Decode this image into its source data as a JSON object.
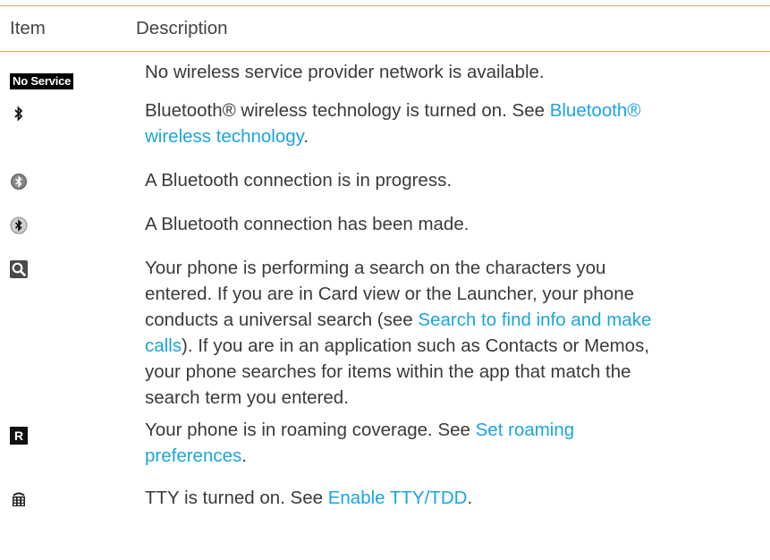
{
  "table": {
    "header": {
      "item": "Item",
      "description": "Description"
    },
    "rows": [
      {
        "icon": "no-service-icon",
        "icon_text": "No Service",
        "text": "No wireless service provider network is available."
      },
      {
        "icon": "bluetooth-on-icon",
        "text_before": "Bluetooth® wireless technology is turned on. See ",
        "link": "Bluetooth® wireless technology",
        "text_after": "."
      },
      {
        "icon": "bluetooth-connecting-icon",
        "text": "A Bluetooth connection is in progress."
      },
      {
        "icon": "bluetooth-connected-icon",
        "text": "A Bluetooth connection has been made."
      },
      {
        "icon": "search-icon",
        "text_before": "Your phone is performing a search on the characters you entered. If you are in Card view or the Launcher, your phone conducts a universal search (see ",
        "link": "Search to find info and make calls",
        "text_after": "). If you are in an application such as Contacts or Memos, your phone searches for items within the app that match the search term you entered."
      },
      {
        "icon": "roaming-icon",
        "icon_text": "R",
        "text_before": "Your phone is in roaming coverage. See ",
        "link": "Set roaming preferences",
        "text_after": "."
      },
      {
        "icon": "tty-icon",
        "text_before": "TTY is turned on. See ",
        "link": "Enable TTY/TDD",
        "text_after": "."
      }
    ]
  },
  "colors": {
    "rule": "#e8a35a",
    "link": "#1aa4e0",
    "text": "#3a3a3a"
  }
}
